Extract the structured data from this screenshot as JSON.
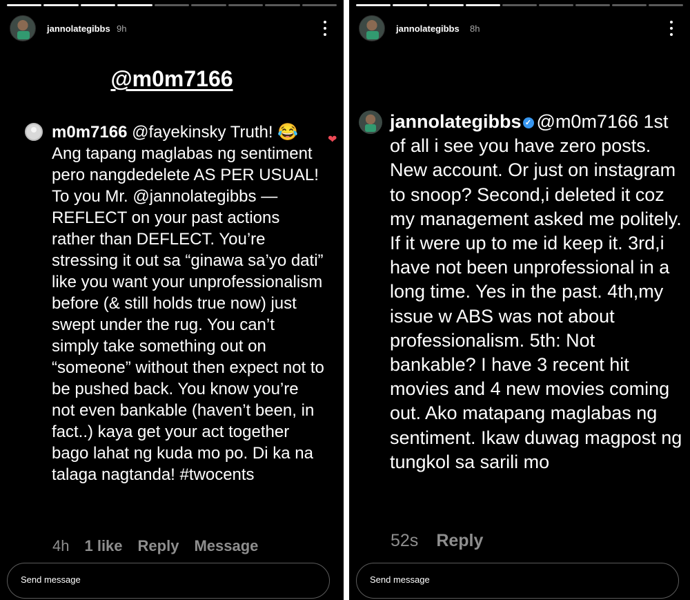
{
  "left_story": {
    "username": "jannolategibbs",
    "time": "9h",
    "progress": {
      "total": 9,
      "completed": 4
    },
    "mention_title": "@m0m7166",
    "comment": {
      "username": "m0m7166",
      "text": " @fayekinsky Truth! 😂 Ang tapang maglabas ng sentiment pero nangdedelete AS PER USUAL! To you Mr. @jannolategibbs —REFLECT on your past actions rather than DEFLECT. You’re stressing it out sa “ginawa sa’yo dati” like you want your unprofessionalism before (& still holds true now) just swept under the rug. You can’t simply take something out on “someone” without then expect not to be pushed back. You know you’re not even bankable (haven’t been, in fact..) kaya get your act together bago lahat ng kuda mo po. Di ka na talaga nagtanda! #twocents",
      "time": "4h",
      "likes": "1 like",
      "reply_label": "Reply",
      "message_label": "Message",
      "heart_icon": "heart-icon"
    },
    "send_placeholder": "Send message"
  },
  "right_story": {
    "username": "jannolategibbs",
    "time": "8h",
    "progress": {
      "total": 9,
      "completed": 4
    },
    "reply": {
      "username": "jannolategibbs",
      "mention": "@m0m7166",
      "text": " 1st of all i see you have zero posts. New account. Or just on instagram to snoop? Second,i deleted it coz my management asked me politely. If it were up to me id keep it. 3rd,i have not been unprofessional in a long time. Yes in the past. 4th,my issue w ABS was not about professionalism. 5th: Not bankable? I have 3 recent hit movies and 4 new movies coming out. Ako matapang maglabas ng sentiment. Ikaw duwag magpost ng tungkol sa sarili mo",
      "time": "52s",
      "reply_label": "Reply",
      "verified_badge": "verified-badge-icon"
    },
    "send_placeholder": "Send message"
  },
  "colors": {
    "background": "#000000",
    "divider": "#ffffff",
    "muted": "#8e8e8e",
    "like_heart": "#ed4956",
    "verified": "#3897f0"
  }
}
